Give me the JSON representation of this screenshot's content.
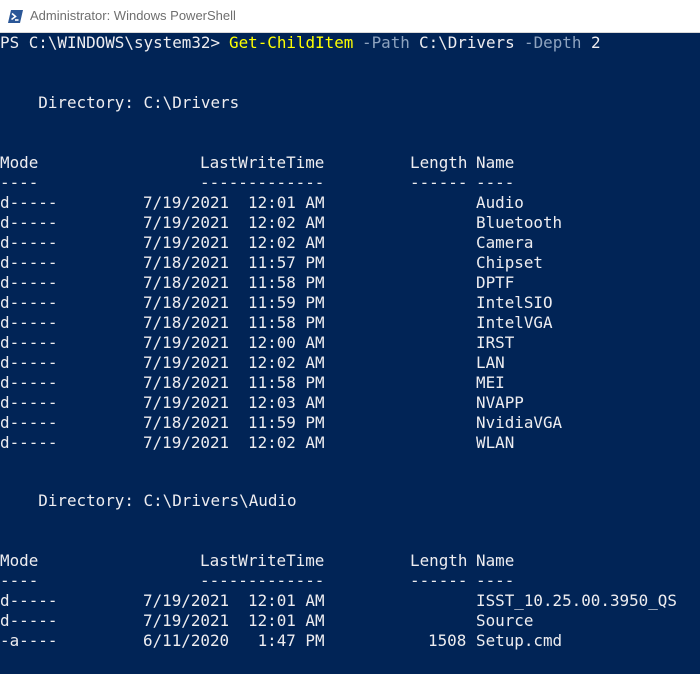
{
  "window": {
    "title": "Administrator: Windows PowerShell",
    "colors": {
      "console_bg": "#012456",
      "text": "#eeedf0",
      "command": "#ffff00",
      "parameter": "#8ea3bf"
    }
  },
  "prompt": {
    "text": "PS C:\\WINDOWS\\system32> ",
    "cmdlet": "Get-ChildItem",
    "param1": "-Path",
    "arg1": "C:\\Drivers",
    "param2": "-Depth",
    "arg2": "2"
  },
  "headers": {
    "mode": "Mode",
    "lastwrite": "LastWriteTime",
    "length": "Length",
    "name": "Name",
    "mode_sep": "----",
    "lastwrite_sep": "-------------",
    "length_sep": "------",
    "name_sep": "----"
  },
  "sections": [
    {
      "directory_label": "    Directory: C:\\Drivers",
      "rows": [
        {
          "mode": "d-----",
          "date": "7/19/2021",
          "time": "12:01 AM",
          "length": "",
          "name": "Audio"
        },
        {
          "mode": "d-----",
          "date": "7/19/2021",
          "time": "12:02 AM",
          "length": "",
          "name": "Bluetooth"
        },
        {
          "mode": "d-----",
          "date": "7/19/2021",
          "time": "12:02 AM",
          "length": "",
          "name": "Camera"
        },
        {
          "mode": "d-----",
          "date": "7/18/2021",
          "time": "11:57 PM",
          "length": "",
          "name": "Chipset"
        },
        {
          "mode": "d-----",
          "date": "7/18/2021",
          "time": "11:58 PM",
          "length": "",
          "name": "DPTF"
        },
        {
          "mode": "d-----",
          "date": "7/18/2021",
          "time": "11:59 PM",
          "length": "",
          "name": "IntelSIO"
        },
        {
          "mode": "d-----",
          "date": "7/18/2021",
          "time": "11:58 PM",
          "length": "",
          "name": "IntelVGA"
        },
        {
          "mode": "d-----",
          "date": "7/19/2021",
          "time": "12:00 AM",
          "length": "",
          "name": "IRST"
        },
        {
          "mode": "d-----",
          "date": "7/19/2021",
          "time": "12:02 AM",
          "length": "",
          "name": "LAN"
        },
        {
          "mode": "d-----",
          "date": "7/18/2021",
          "time": "11:58 PM",
          "length": "",
          "name": "MEI"
        },
        {
          "mode": "d-----",
          "date": "7/19/2021",
          "time": "12:03 AM",
          "length": "",
          "name": "NVAPP"
        },
        {
          "mode": "d-----",
          "date": "7/18/2021",
          "time": "11:59 PM",
          "length": "",
          "name": "NvidiaVGA"
        },
        {
          "mode": "d-----",
          "date": "7/19/2021",
          "time": "12:02 AM",
          "length": "",
          "name": "WLAN"
        }
      ]
    },
    {
      "directory_label": "    Directory: C:\\Drivers\\Audio",
      "rows": [
        {
          "mode": "d-----",
          "date": "7/19/2021",
          "time": "12:01 AM",
          "length": "",
          "name": "ISST_10.25.00.3950_QS"
        },
        {
          "mode": "d-----",
          "date": "7/19/2021",
          "time": "12:01 AM",
          "length": "",
          "name": "Source"
        },
        {
          "mode": "-a----",
          "date": "6/11/2020",
          "time": " 1:47 PM",
          "length": "1508",
          "name": "Setup.cmd"
        }
      ]
    }
  ]
}
